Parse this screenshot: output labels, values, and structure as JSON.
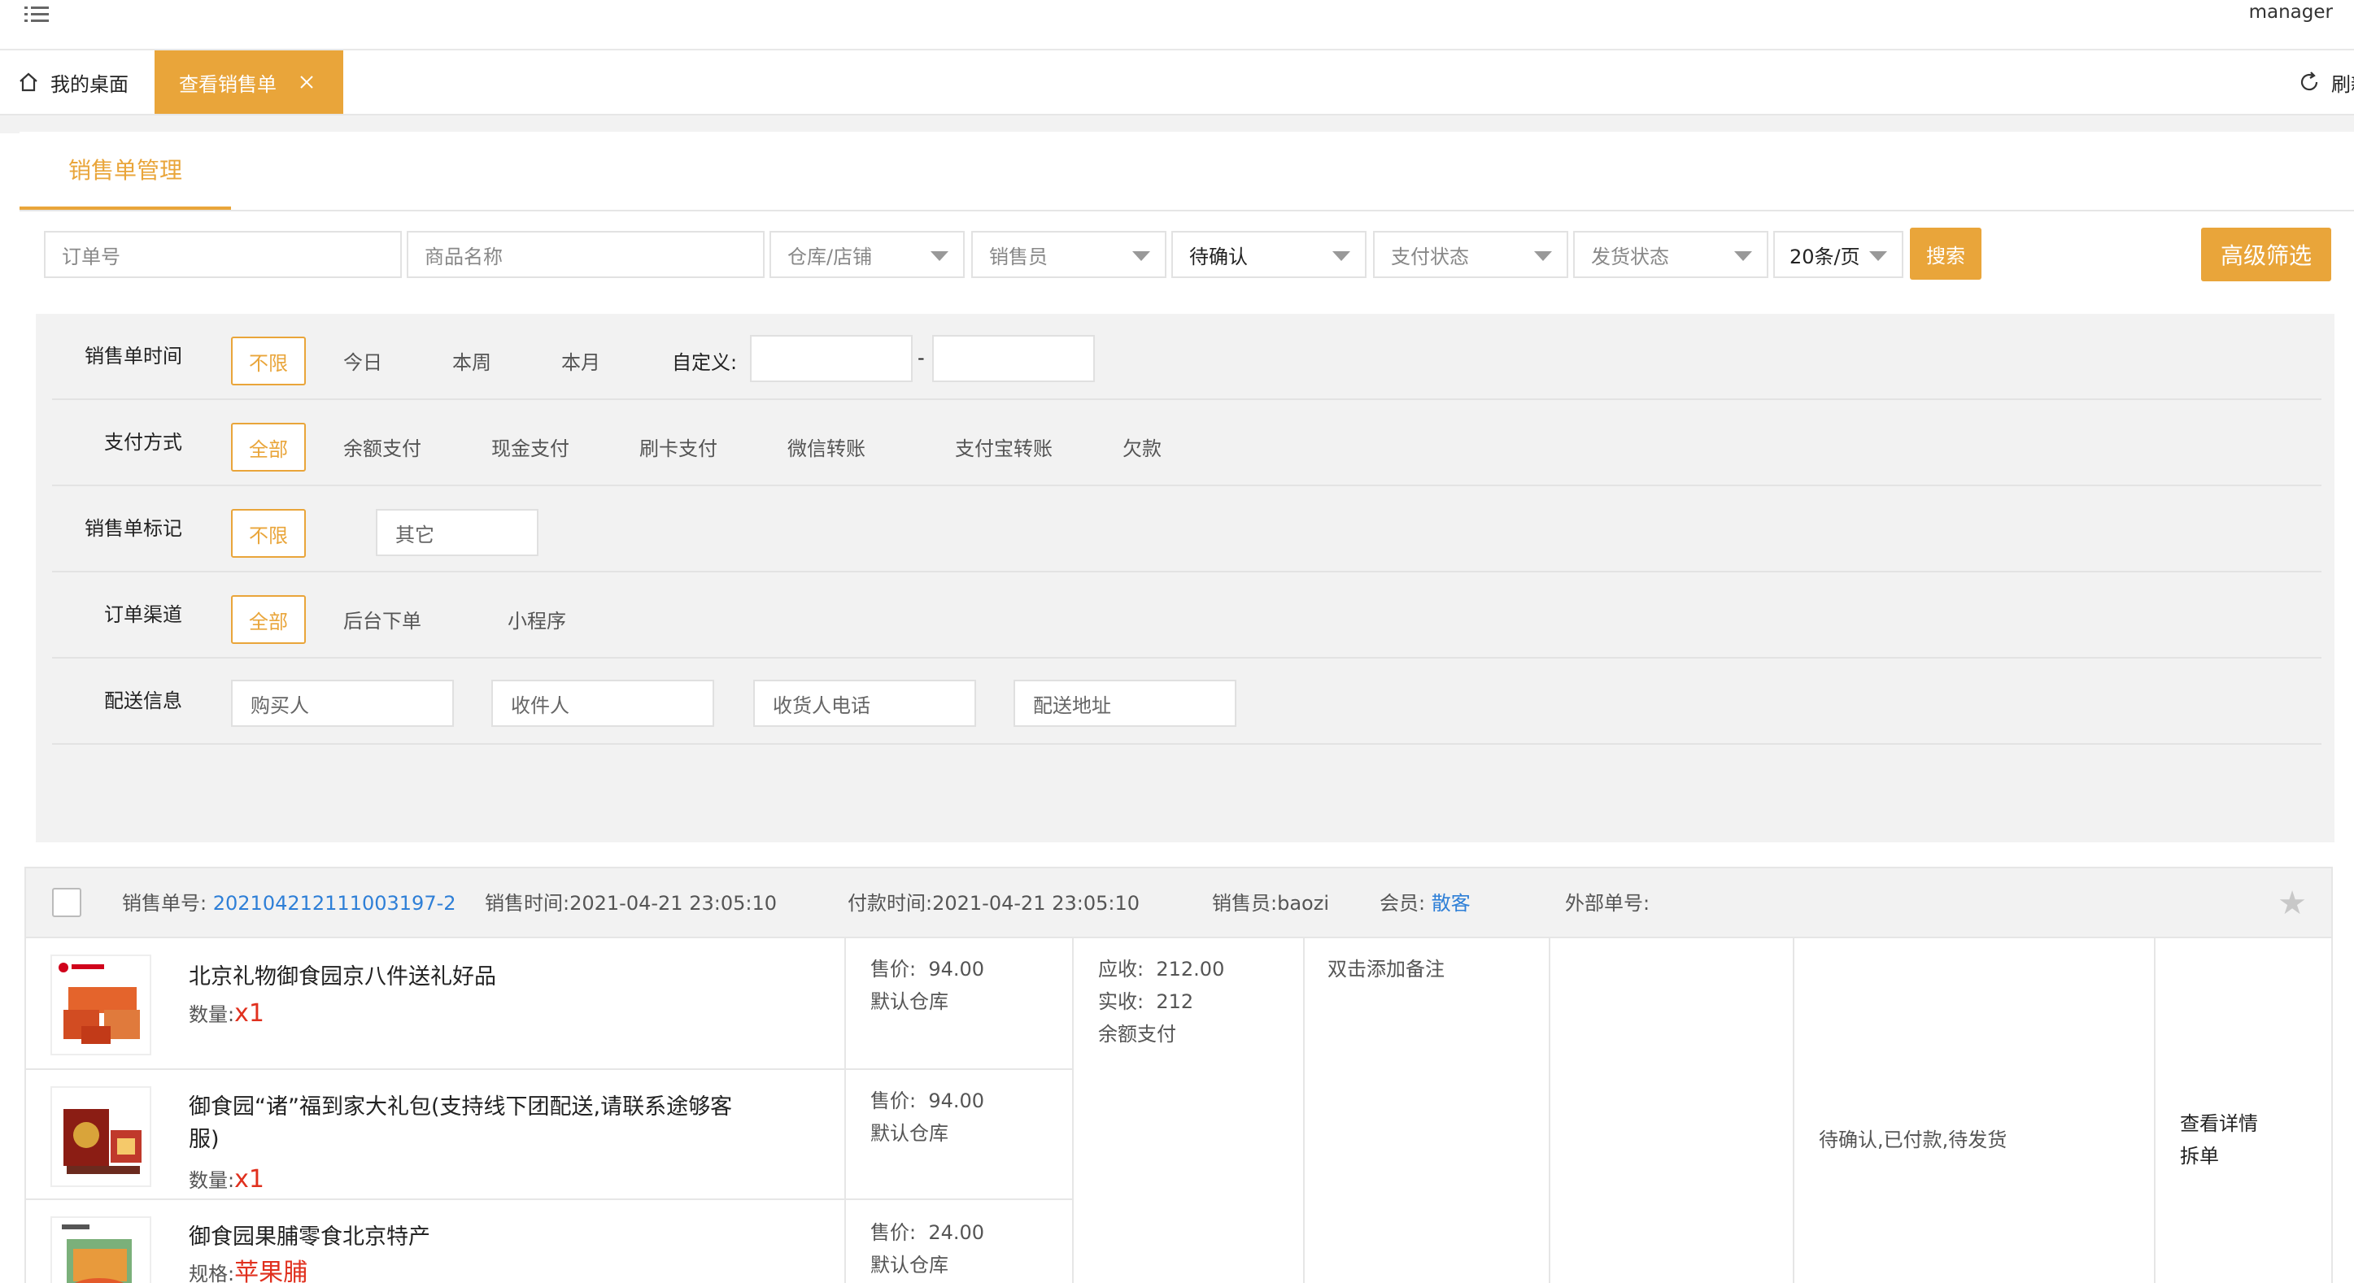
{
  "header": {
    "user": "manager",
    "menu_icon": "list-icon"
  },
  "tabs": {
    "home_label": "我的桌面",
    "active_label": "查看销售单",
    "refresh_label": "刷新"
  },
  "section": {
    "title": "销售单管理"
  },
  "search": {
    "order_no_placeholder": "订单号",
    "product_placeholder": "商品名称",
    "warehouse": "仓库/店铺",
    "salesperson": "销售员",
    "status": "待确认",
    "pay_status": "支付状态",
    "ship_status": "发货状态",
    "page_size": "20条/页",
    "search_button": "搜索",
    "advanced_button": "高级筛选"
  },
  "filters": {
    "time": {
      "label": "销售单时间",
      "options": [
        "不限",
        "今日",
        "本周",
        "本月"
      ],
      "custom_label": "自定义:",
      "separator": "-"
    },
    "payment": {
      "label": "支付方式",
      "options": [
        "全部",
        "余额支付",
        "现金支付",
        "刷卡支付",
        "微信转账",
        "支付宝转账",
        "欠款"
      ]
    },
    "mark": {
      "label": "销售单标记",
      "options": [
        "不限",
        "其它"
      ]
    },
    "channel": {
      "label": "订单渠道",
      "options": [
        "全部",
        "后台下单",
        "小程序"
      ]
    },
    "delivery": {
      "label": "配送信息",
      "placeholders": [
        "购买人",
        "收件人",
        "收货人电话",
        "配送地址"
      ]
    }
  },
  "order": {
    "no_label": "销售单号:",
    "no": "202104212111003197-2",
    "sale_time_label": "销售时间:",
    "sale_time": "2021-04-21 23:05:10",
    "pay_time_label": "付款时间:",
    "pay_time": "2021-04-21 23:05:10",
    "seller_label": "销售员:",
    "seller": "baozi",
    "member_label": "会员:",
    "member": "散客",
    "external_label": "外部单号:",
    "receivable_label": "应收:",
    "receivable": "212.00",
    "received_label": "实收:",
    "received": "212",
    "pay_method": "余额支付",
    "remark": "双击添加备注",
    "status": "待确认,已付款,待发货",
    "actions": [
      "查看详情",
      "拆单"
    ],
    "items": [
      {
        "name": "北京礼物御食园京八件送礼好品",
        "qty_label": "数量:",
        "qty": "x1",
        "price_label": "售价:",
        "price": "94.00",
        "warehouse": "默认仓库"
      },
      {
        "name_line1": "御食园“诸”福到家大礼包(支持线下团配送,请联系途够客",
        "name_line2": "服)",
        "qty_label": "数量:",
        "qty": "x1",
        "price_label": "售价:",
        "price": "94.00",
        "warehouse": "默认仓库"
      },
      {
        "name": "御食园果脯零食北京特产",
        "spec_label": "规格:",
        "spec": "苹果脯",
        "price_label": "售价:",
        "price": "24.00",
        "warehouse": "默认仓库"
      }
    ]
  }
}
